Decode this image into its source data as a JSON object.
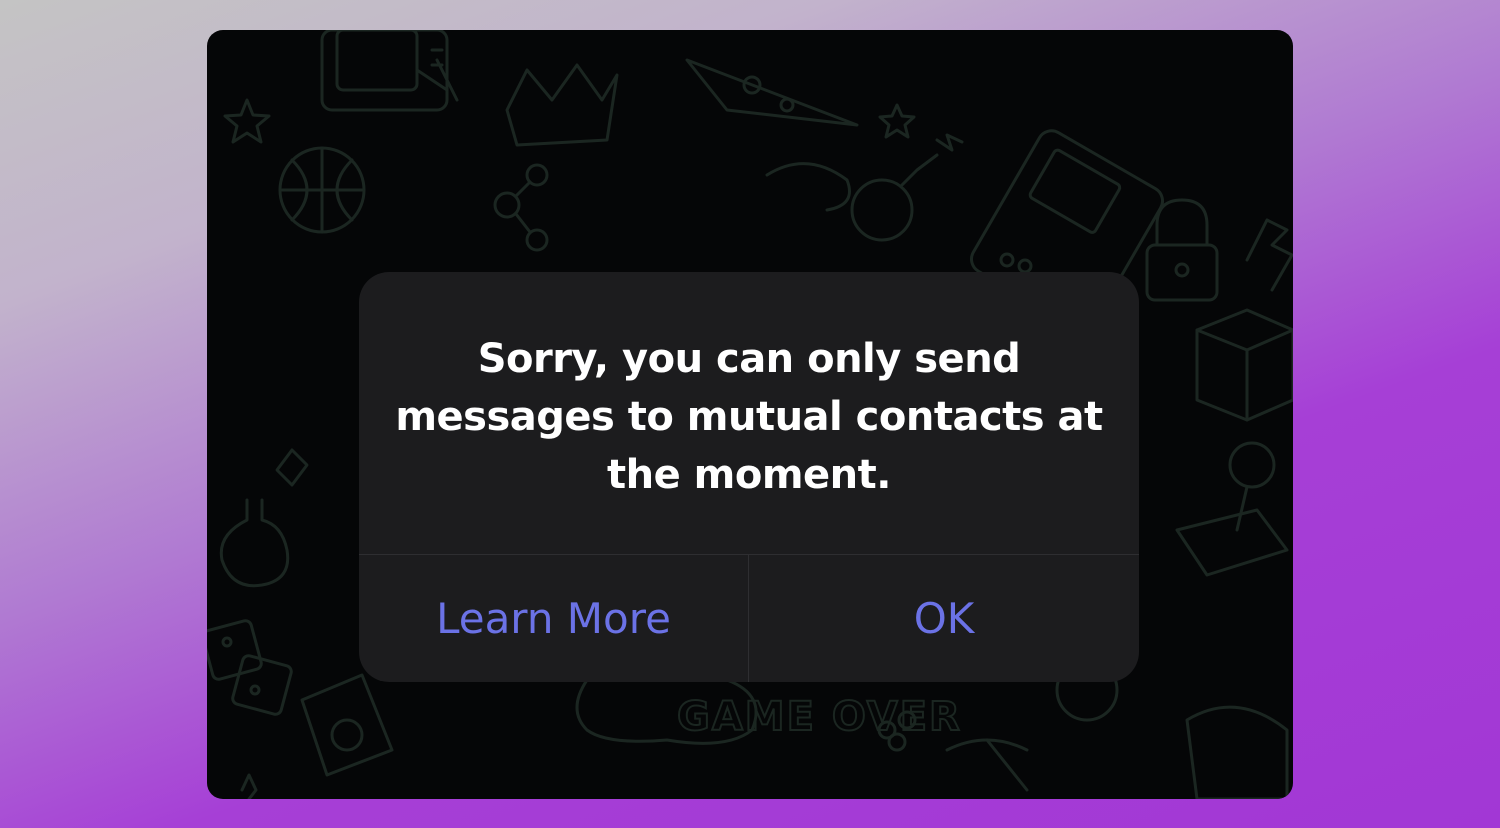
{
  "alert": {
    "message": "Sorry, you can only send messages to mutual contacts at the moment.",
    "buttons": {
      "learn_more": "Learn More",
      "ok": "OK"
    }
  },
  "wallpaper": {
    "watermark_text": "GAME OVER"
  },
  "colors": {
    "page_background_gradient": [
      "#c4c4c4",
      "#a237d5"
    ],
    "screen_background": "#050607",
    "alert_background": "#1c1c1e",
    "alert_text": "#ffffff",
    "button_text": "#6b72e6",
    "doodle_stroke": "#1b2621"
  },
  "icons": [
    "television-icon",
    "crown-icon",
    "pizza-icon",
    "basketball-icon",
    "molecule-icon",
    "bomb-icon",
    "gameboy-icon",
    "padlock-icon",
    "rubiks-cube-icon",
    "joystick-icon",
    "potion-flask-icon",
    "dice-icon",
    "floppy-disk-icon",
    "gamepad-icon",
    "pickaxe-icon",
    "star-icon",
    "flag-icon"
  ]
}
